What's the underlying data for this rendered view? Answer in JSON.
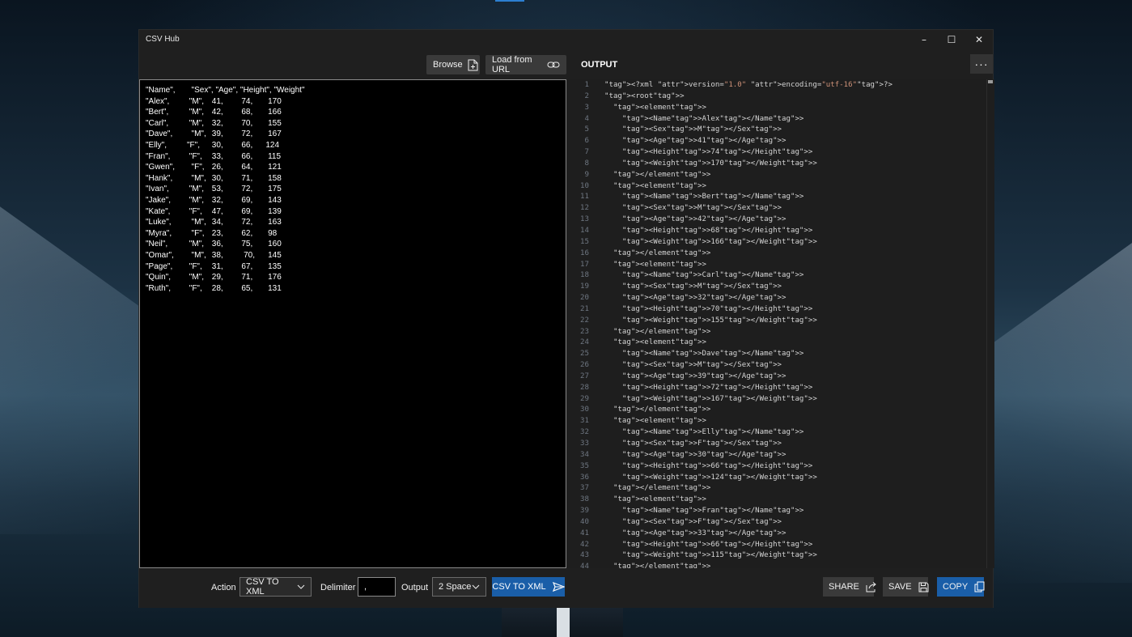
{
  "window": {
    "title": "CSV Hub",
    "minimize_glyph": "–",
    "maximize_glyph": "☐",
    "close_glyph": "✕"
  },
  "toolbar": {
    "browse_label": "Browse",
    "browse_icon": "file-add-icon",
    "load_url_label": "Load from URL",
    "load_url_icon": "link-icon",
    "output_label": "OUTPUT",
    "more_glyph": "···"
  },
  "input": {
    "rows": [
      [
        "\"Name\",",
        "  \"Sex\", \"Age\", \"Height\", \"Weight\"",
        "",
        "",
        ""
      ],
      [
        "\"Alex\",",
        " \"M\",",
        " 41,",
        "   74,",
        "    170"
      ],
      [
        "\"Bert\",",
        " \"M\",",
        " 42,",
        "   68,",
        "    166"
      ],
      [
        "\"Carl\",",
        " \"M\",",
        " 32,",
        "   70,",
        "    155"
      ],
      [
        "\"Dave\",",
        "  \"M\",",
        " 39,",
        "   72,",
        "    167"
      ],
      [
        "\"Elly\",",
        "\"F\",",
        " 30,",
        "   66,",
        "   124"
      ],
      [
        "\"Fran\",",
        " \"F\",",
        " 33,",
        "   66,",
        "    115"
      ],
      [
        "\"Gwen\",",
        "  \"F\",",
        " 26,",
        "   64,",
        "    121"
      ],
      [
        "\"Hank\",",
        "  \"M\",",
        " 30,",
        "   71,",
        "    158"
      ],
      [
        "\"Ivan\",",
        " \"M\",",
        " 53,",
        "   72,",
        "    175"
      ],
      [
        "\"Jake\",",
        " \"M\",",
        " 32,",
        "   69,",
        "    143"
      ],
      [
        "\"Kate\",",
        " \"F\",",
        " 47,",
        "   69,",
        "    139"
      ],
      [
        "\"Luke\",",
        "  \"M\",",
        " 34,",
        "   72,",
        "    163"
      ],
      [
        "\"Myra\",",
        "  \"F\",",
        " 23,",
        "   62,",
        "    98"
      ],
      [
        "\"Neil\",",
        " \"M\",",
        " 36,",
        "   75,",
        "    160"
      ],
      [
        "\"Omar\",",
        "  \"M\",",
        " 38,",
        "    70,",
        "    145"
      ],
      [
        "\"Page\",",
        " \"F\",",
        " 31,",
        "   67,",
        "    135"
      ],
      [
        "\"Quin\",",
        " \"M\",",
        " 29,",
        "   71,",
        "    176"
      ],
      [
        "\"Ruth\",",
        " \"F\",",
        " 28,",
        "   65,",
        "    131"
      ]
    ]
  },
  "output": {
    "lines": [
      "<?xml version=\"1.0\" encoding=\"utf-16\"?>",
      "<root>",
      "  <element>",
      "    <Name>Alex</Name>",
      "    <Sex>M</Sex>",
      "    <Age>41</Age>",
      "    <Height>74</Height>",
      "    <Weight>170</Weight>",
      "  </element>",
      "  <element>",
      "    <Name>Bert</Name>",
      "    <Sex>M</Sex>",
      "    <Age>42</Age>",
      "    <Height>68</Height>",
      "    <Weight>166</Weight>",
      "  </element>",
      "  <element>",
      "    <Name>Carl</Name>",
      "    <Sex>M</Sex>",
      "    <Age>32</Age>",
      "    <Height>70</Height>",
      "    <Weight>155</Weight>",
      "  </element>",
      "  <element>",
      "    <Name>Dave</Name>",
      "    <Sex>M</Sex>",
      "    <Age>39</Age>",
      "    <Height>72</Height>",
      "    <Weight>167</Weight>",
      "  </element>",
      "  <element>",
      "    <Name>Elly</Name>",
      "    <Sex>F</Sex>",
      "    <Age>30</Age>",
      "    <Height>66</Height>",
      "    <Weight>124</Weight>",
      "  </element>",
      "  <element>",
      "    <Name>Fran</Name>",
      "    <Sex>F</Sex>",
      "    <Age>33</Age>",
      "    <Height>66</Height>",
      "    <Weight>115</Weight>",
      "  </element>"
    ]
  },
  "bottombar": {
    "action_label": "Action",
    "action_value": "CSV TO XML",
    "delimiter_label": "Delimiter",
    "delimiter_value": ",",
    "output_label": "Output",
    "output_value": "2 Space",
    "convert_label": "CSV TO XML",
    "convert_icon": "send-icon",
    "share_label": "SHARE",
    "share_icon": "share-icon",
    "save_label": "SAVE",
    "save_icon": "floppy-disk-icon",
    "copy_label": "COPY",
    "copy_icon": "copy-icon"
  },
  "colors": {
    "accent": "#1a5ea8",
    "xml_tag": "#569cd6",
    "xml_attr": "#9cdcfe",
    "xml_string": "#ce9178"
  }
}
